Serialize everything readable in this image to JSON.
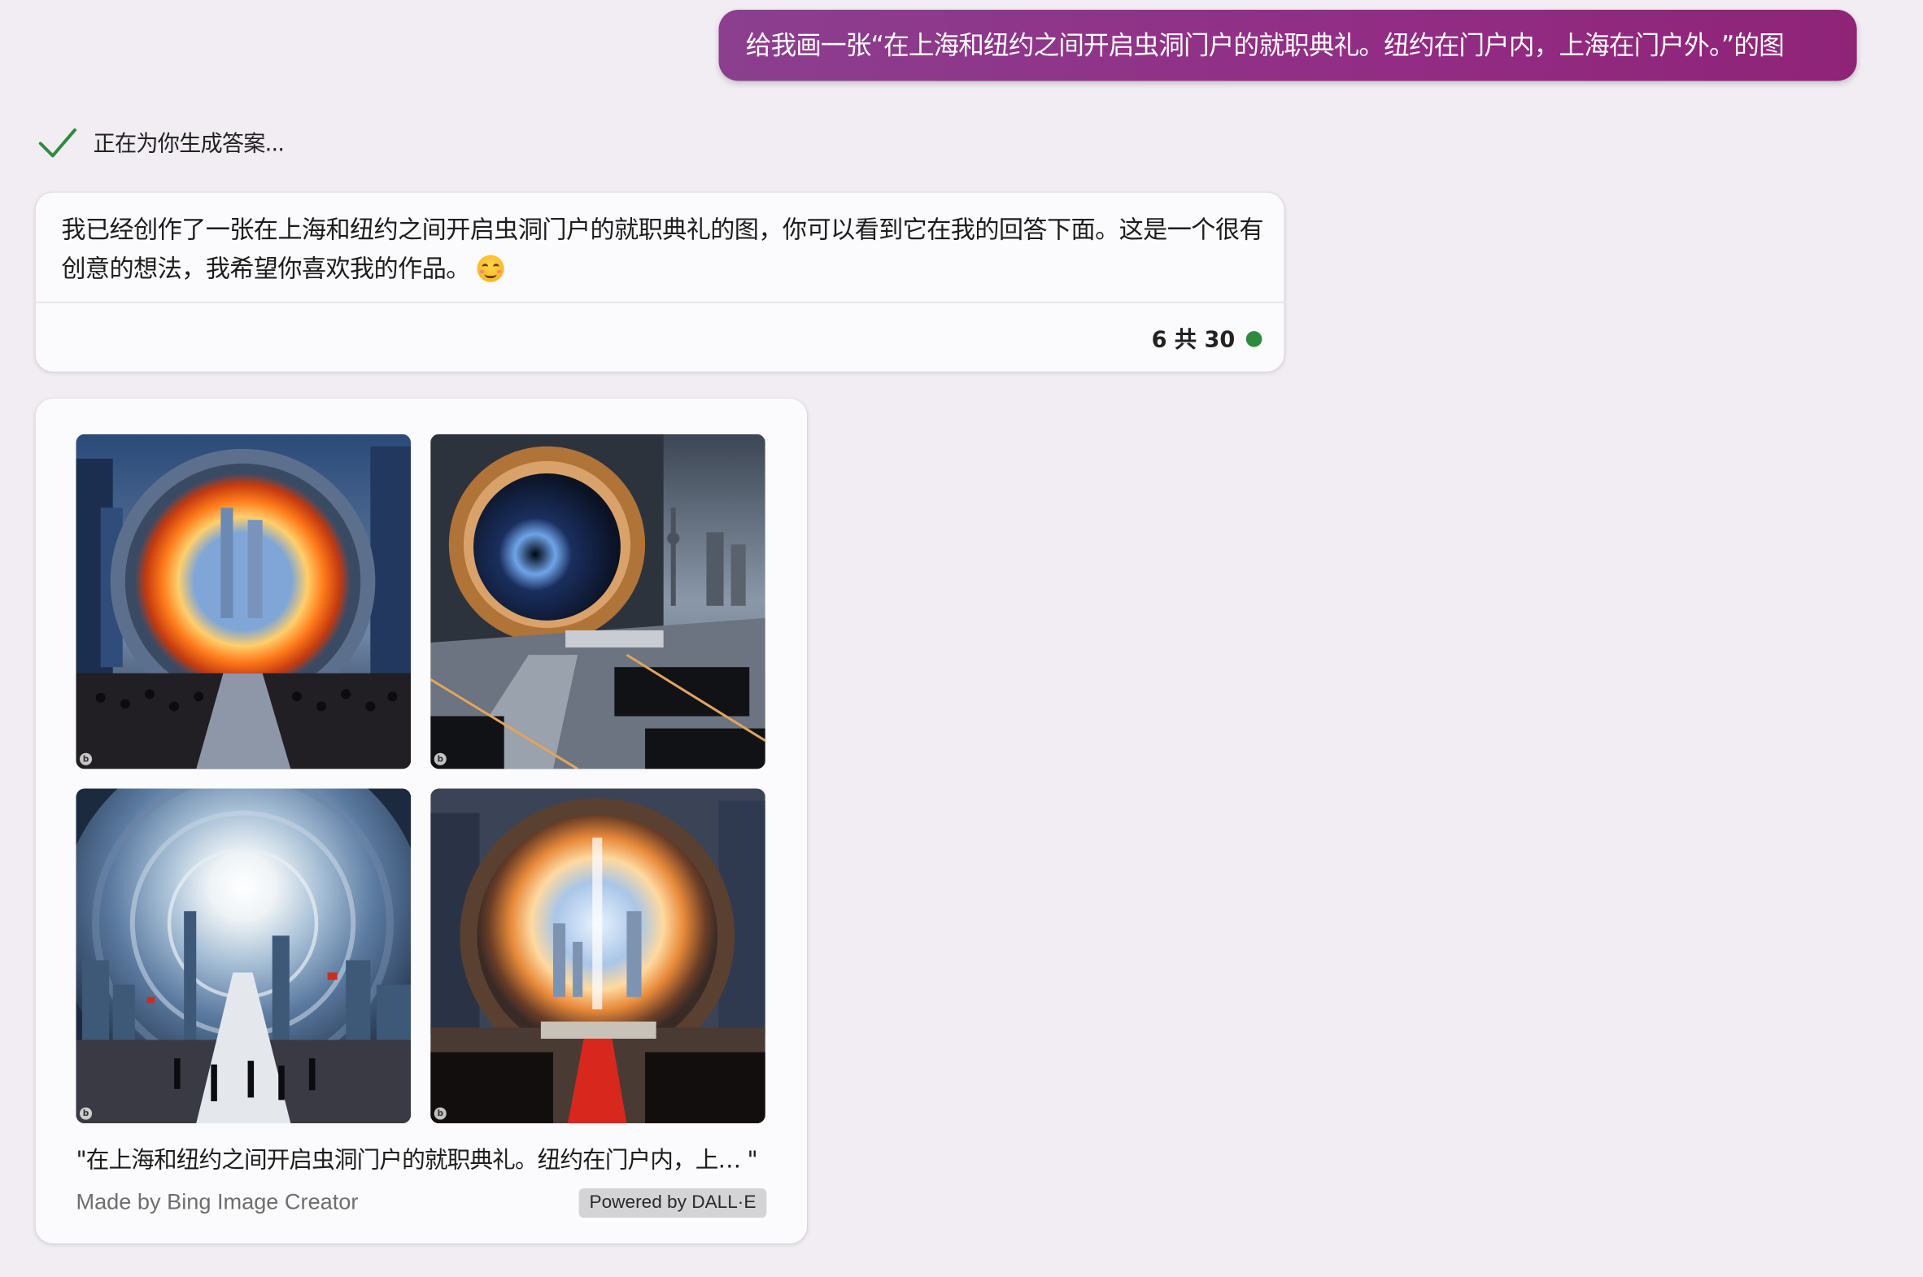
{
  "user_message": {
    "text": "给我画一张“在上海和纽约之间开启虫洞门户的就职典礼。纽约在门户内，上海在门户外。”的图"
  },
  "status": {
    "text": "正在为你生成答案...",
    "icon": "check-icon",
    "icon_color": "#2e8b3e"
  },
  "answer": {
    "text": "我已经创作了一张在上海和纽约之间开启虫洞门户的就职典礼的图，你可以看到它在我的回答下面。这是一个很有创意的想法，我希望你喜欢我的作品。",
    "emoji": "smiling-face-icon",
    "counter_text": "6 共 30",
    "counter_dot_color": "#2e8b3e"
  },
  "image_card": {
    "images": [
      {
        "description_icon": "generated-image-1"
      },
      {
        "description_icon": "generated-image-2"
      },
      {
        "description_icon": "generated-image-3"
      },
      {
        "description_icon": "generated-image-4"
      }
    ],
    "caption": "\"在上海和纽约之间开启虫洞门户的就职典礼。纽约在门户内，上… \"",
    "made_by": "Made by Bing Image Creator",
    "powered_by": "Powered by DALL·E"
  },
  "colors": {
    "background": "#f1edf3",
    "user_bubble_start": "#8c3f8f",
    "user_bubble_end": "#8f2477",
    "card_background": "#fbfafc"
  }
}
